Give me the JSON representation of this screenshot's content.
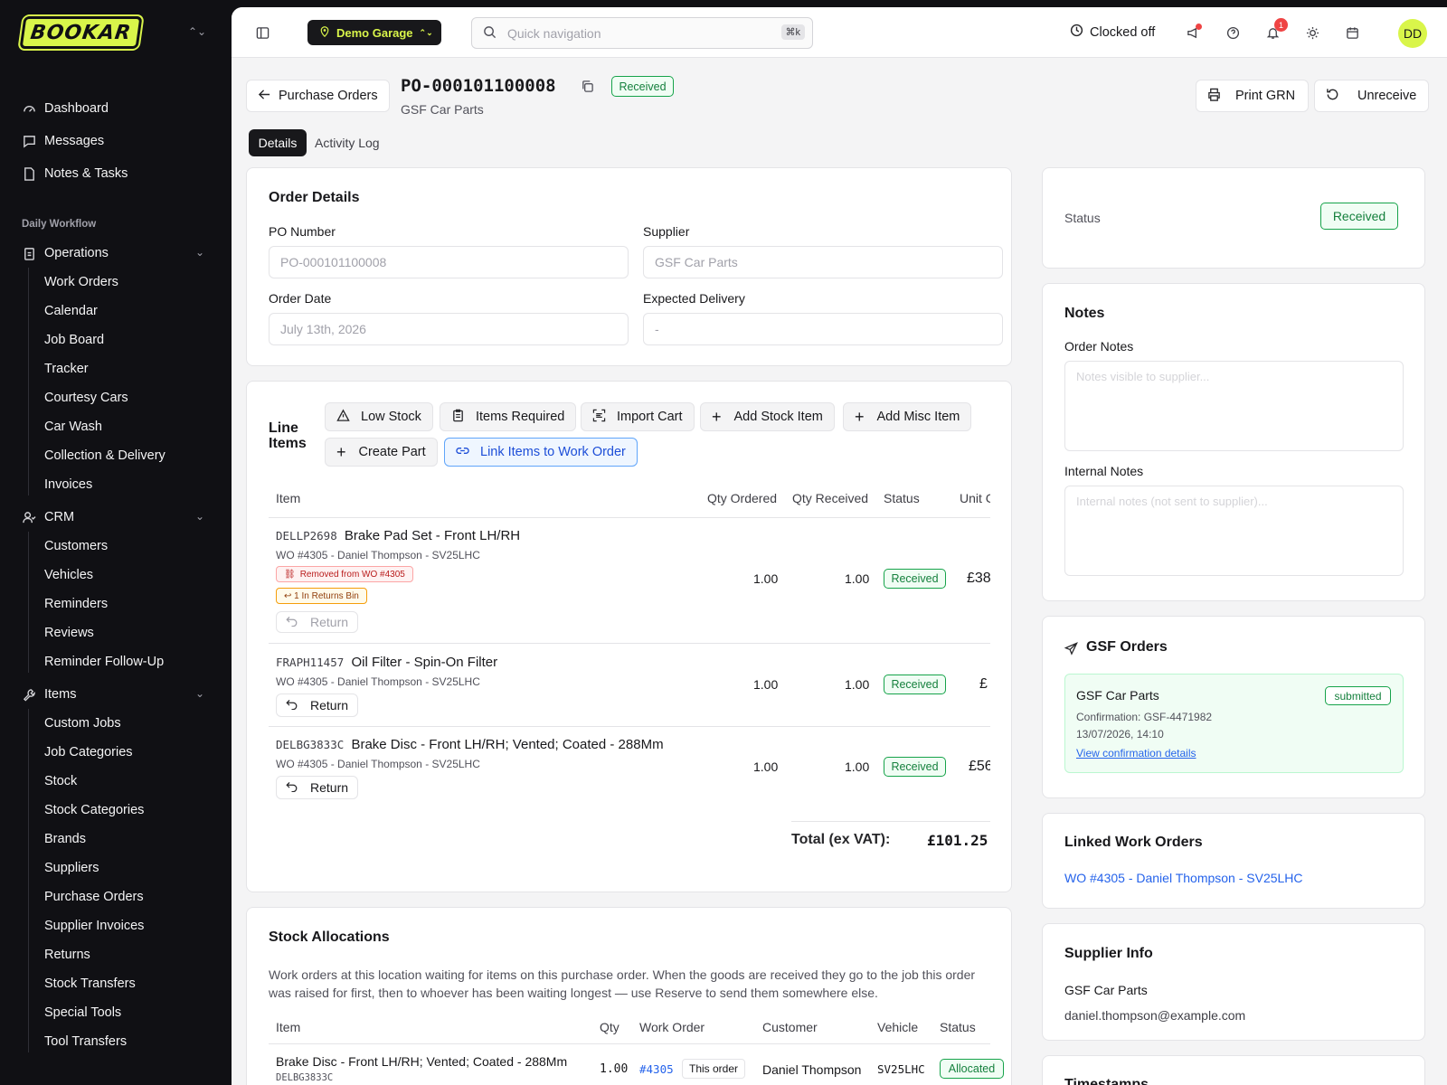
{
  "brand": {
    "logo_text": "BOOKAR"
  },
  "nav": {
    "top": [
      {
        "label": "Dashboard"
      },
      {
        "label": "Messages"
      },
      {
        "label": "Notes & Tasks"
      }
    ],
    "section_label": "Daily Workflow",
    "operations": {
      "label": "Operations",
      "items": [
        "Work Orders",
        "Calendar",
        "Job Board",
        "Tracker",
        "Courtesy Cars",
        "Car Wash",
        "Collection & Delivery",
        "Invoices"
      ]
    },
    "crm": {
      "label": "CRM",
      "items": [
        "Customers",
        "Vehicles",
        "Reminders",
        "Reviews",
        "Reminder Follow-Up"
      ]
    },
    "items": {
      "label": "Items",
      "items": [
        "Custom Jobs",
        "Job Categories",
        "Stock",
        "Stock Categories",
        "Brands",
        "Suppliers",
        "Purchase Orders",
        "Supplier Invoices",
        "Returns",
        "Stock Transfers",
        "Special Tools",
        "Tool Transfers"
      ]
    }
  },
  "topbar": {
    "location": "Demo Garage",
    "search_placeholder": "Quick navigation",
    "shortcut": "⌘k",
    "clock_status": "Clocked off",
    "notif_count": "1",
    "avatar": "DD"
  },
  "header": {
    "back_label": "Purchase Orders",
    "po_number": "PO-000101100008",
    "status": "Received",
    "supplier": "GSF Car Parts",
    "print_label": "Print GRN",
    "unreceive_label": "Unreceive"
  },
  "tabs": [
    {
      "label": "Details"
    },
    {
      "label": "Activity Log"
    }
  ],
  "order_details": {
    "title": "Order Details",
    "po_label": "PO Number",
    "po_value": "PO-000101100008",
    "supplier_label": "Supplier",
    "supplier_value": "GSF Car Parts",
    "order_date_label": "Order Date",
    "order_date_value": "July 13th, 2026",
    "delivery_label": "Expected Delivery",
    "delivery_value": "-"
  },
  "line_items": {
    "title_line1": "Line",
    "title_line2": "Items",
    "actions": {
      "low_stock": "Low Stock",
      "items_required": "Items Required",
      "import_cart": "Import Cart",
      "add_stock": "Add Stock Item",
      "add_misc": "Add Misc Item",
      "create_part": "Create Part",
      "link_items": "Link Items to Work Order"
    },
    "columns": {
      "item": "Item",
      "qty_ordered": "Qty Ordered",
      "qty_received": "Qty Received",
      "status": "Status",
      "unit": "Unit C"
    },
    "rows": [
      {
        "code": "DELLP2698",
        "name": "Brake Pad Set - Front LH/RH",
        "wo": "WO #4305 - Daniel Thompson - SV25LHC",
        "tag_removed": "Removed from WO #4305",
        "tag_returns": "↩ 1 In Returns Bin",
        "qty_ordered": "1.00",
        "qty_received": "1.00",
        "status": "Received",
        "unit": "£38",
        "return_label": "Return"
      },
      {
        "code": "FRAPH11457",
        "name": "Oil Filter - Spin-On Filter",
        "wo": "WO #4305 - Daniel Thompson - SV25LHC",
        "qty_ordered": "1.00",
        "qty_received": "1.00",
        "status": "Received",
        "unit": "£",
        "return_label": "Return"
      },
      {
        "code": "DELBG3833C",
        "name": "Brake Disc - Front LH/RH; Vented; Coated - 288Mm",
        "wo": "WO #4305 - Daniel Thompson - SV25LHC",
        "qty_ordered": "1.00",
        "qty_received": "1.00",
        "status": "Received",
        "unit": "£56",
        "return_label": "Return"
      }
    ],
    "total_label": "Total (ex VAT):",
    "total_value": "£101.25"
  },
  "stock_alloc": {
    "title": "Stock Allocations",
    "description_line1": "Work orders at this location waiting for items on this purchase order. When the goods are received they go to the job this order",
    "description_line2": "was raised for first, then to whoever has been waiting longest — use Reserve to send them somewhere else.",
    "columns": {
      "item": "Item",
      "qty": "Qty",
      "work_order": "Work Order",
      "customer": "Customer",
      "vehicle": "Vehicle",
      "status": "Status"
    },
    "row": {
      "item": "Brake Disc - Front LH/RH; Vented; Coated - 288Mm",
      "code": "DELBG3833C",
      "qty": "1.00",
      "work_order": "#4305",
      "this_order": "This order",
      "customer": "Daniel Thompson",
      "vehicle": "SV25LHC",
      "status": "Allocated"
    }
  },
  "right": {
    "status_label": "Status",
    "status_value": "Received",
    "notes_title": "Notes",
    "order_notes_label": "Order Notes",
    "order_notes_placeholder": "Notes visible to supplier...",
    "internal_notes_label": "Internal Notes",
    "internal_notes_placeholder": "Internal notes (not sent to supplier)...",
    "gsf_title": "GSF Orders",
    "gsf_supplier": "GSF Car Parts",
    "gsf_badge": "submitted",
    "gsf_confirmation": "Confirmation: GSF-4471982",
    "gsf_datetime": "13/07/2026, 14:10",
    "gsf_link": "View confirmation details",
    "linked_title": "Linked Work Orders",
    "linked_link": "WO #4305 - Daniel Thompson - SV25LHC",
    "supplier_title": "Supplier Info",
    "supplier_name": "GSF Car Parts",
    "supplier_email": "daniel.thompson@example.com",
    "timestamps_title": "Timestamps"
  }
}
